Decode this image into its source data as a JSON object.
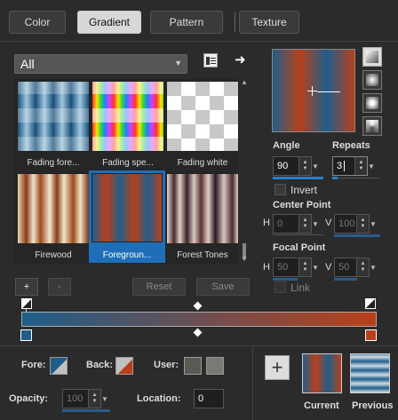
{
  "tabs": [
    {
      "label": "Color"
    },
    {
      "label": "Gradient"
    },
    {
      "label": "Pattern"
    },
    {
      "label": "Texture"
    }
  ],
  "category": {
    "value": "All"
  },
  "swatches": [
    {
      "label": "Fading fore..."
    },
    {
      "label": "Fading spe..."
    },
    {
      "label": "Fading white"
    },
    {
      "label": "Firewood"
    },
    {
      "label": "Foregroun..."
    },
    {
      "label": "Forest Tones"
    }
  ],
  "angle": {
    "label": "Angle",
    "value": "90"
  },
  "repeats": {
    "label": "Repeats",
    "value": "3"
  },
  "invert": {
    "label": "Invert"
  },
  "center_point": {
    "label": "Center Point",
    "h_label": "H",
    "h_value": "0",
    "v_label": "V",
    "v_value": "100"
  },
  "focal_point": {
    "label": "Focal Point",
    "h_label": "H",
    "h_value": "50",
    "v_label": "V",
    "v_value": "50"
  },
  "link": {
    "label": "Link"
  },
  "actions": {
    "add": "+",
    "remove": "-",
    "reset": "Reset",
    "save": "Save"
  },
  "bottom": {
    "fore_label": "Fore:",
    "back_label": "Back:",
    "user_label": "User:",
    "opacity_label": "Opacity:",
    "opacity_value": "100",
    "location_label": "Location:",
    "location_value": "0",
    "add": "+",
    "current_label": "Current",
    "previous_label": "Previous"
  },
  "colors": {
    "accent": "#2b7ec8",
    "fore": "#1f5e8a",
    "back": "#b8401a",
    "user1": "#5a5a55",
    "user2": "#7a7a75"
  }
}
